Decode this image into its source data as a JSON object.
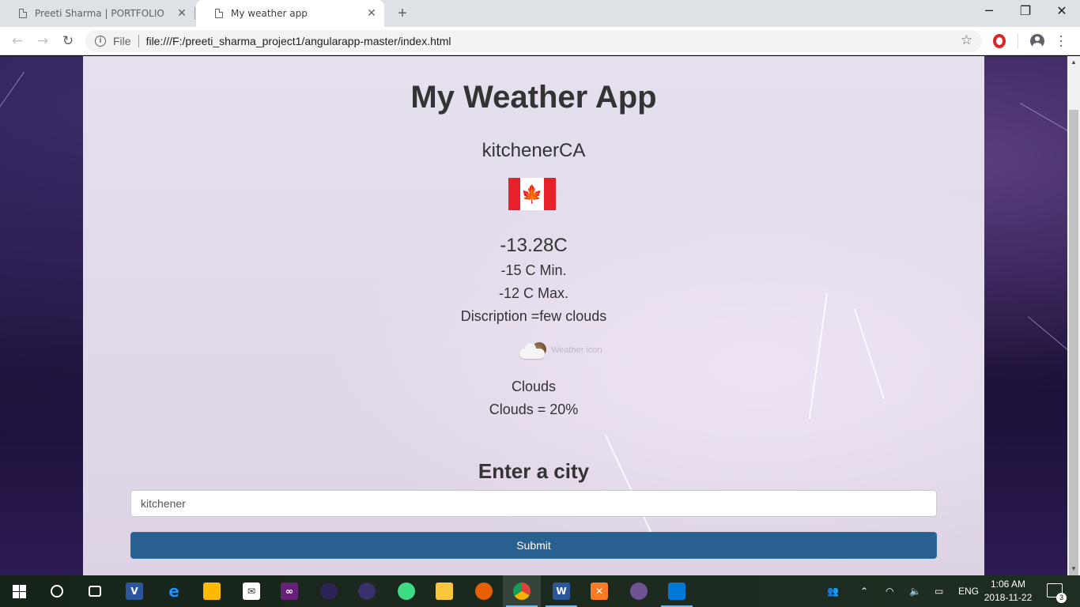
{
  "browser": {
    "tabs": [
      {
        "title": "Preeti Sharma | PORTFOLIO"
      },
      {
        "title": "My weather app"
      }
    ],
    "address": {
      "scheme": "File",
      "url": "file:///F:/preeti_sharma_project1/angularapp-master/index.html"
    }
  },
  "app": {
    "title": "My Weather App",
    "city": "kitchenerCA",
    "temperature": "-13.28C",
    "min": "-15 C Min.",
    "max": "-12 C Max.",
    "description": "Discription =few clouds",
    "icon_alt": "Weather icon",
    "main": "Clouds",
    "clouds": "Clouds = 20%",
    "form": {
      "heading": "Enter a city",
      "input_value": "kitchener",
      "submit_label": "Submit"
    }
  },
  "taskbar": {
    "apps": [
      "start-icon",
      "cortana-icon",
      "task-view-icon",
      "visual-studio-code-icon",
      "edge-icon",
      "store-icon",
      "mail-icon",
      "visual-studio-icon",
      "eclipse-icon",
      "eclipse-ee-icon",
      "android-studio-icon",
      "file-explorer-icon",
      "firefox-icon",
      "chrome-icon",
      "word-icon",
      "xampp-icon",
      "github-desktop-icon",
      "remote-desktop-icon"
    ],
    "language": "ENG",
    "time": "1:06 AM",
    "date": "2018-11-22",
    "notification_count": "3"
  },
  "colors": {
    "submit_bg": "#286090",
    "text": "#333333",
    "flag_red": "#e8202a"
  }
}
